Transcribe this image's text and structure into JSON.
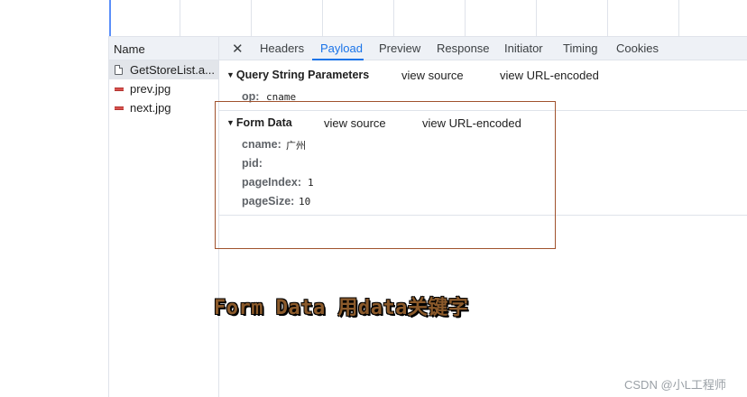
{
  "network": {
    "name_header": "Name",
    "requests": [
      {
        "label": "GetStoreList.a...",
        "type": "document",
        "selected": true
      },
      {
        "label": "prev.jpg",
        "type": "image",
        "selected": false
      },
      {
        "label": "next.jpg",
        "type": "image",
        "selected": false
      }
    ]
  },
  "tabs": {
    "close": "✕",
    "items": [
      "Headers",
      "Payload",
      "Preview",
      "Response",
      "Initiator",
      "Timing",
      "Cookies"
    ],
    "active": "Payload"
  },
  "query_section": {
    "title": "Query String Parameters",
    "view_source": "view source",
    "view_url_encoded": "view URL-encoded",
    "params": [
      {
        "key": "op:",
        "value": "cname"
      }
    ]
  },
  "form_section": {
    "title": "Form Data",
    "view_source": "view source",
    "view_url_encoded": "view URL-encoded",
    "params": [
      {
        "key": "cname:",
        "value": "广州"
      },
      {
        "key": "pid:",
        "value": ""
      },
      {
        "key": "pageIndex:",
        "value": "1"
      },
      {
        "key": "pageSize:",
        "value": "10"
      }
    ]
  },
  "annotation": "Form Data 用data关键字",
  "watermark": "CSDN @小L工程师",
  "colors": {
    "accent": "#1a73e8",
    "highlight_box": "#a0522d",
    "annotation": "#8b5a2b"
  }
}
